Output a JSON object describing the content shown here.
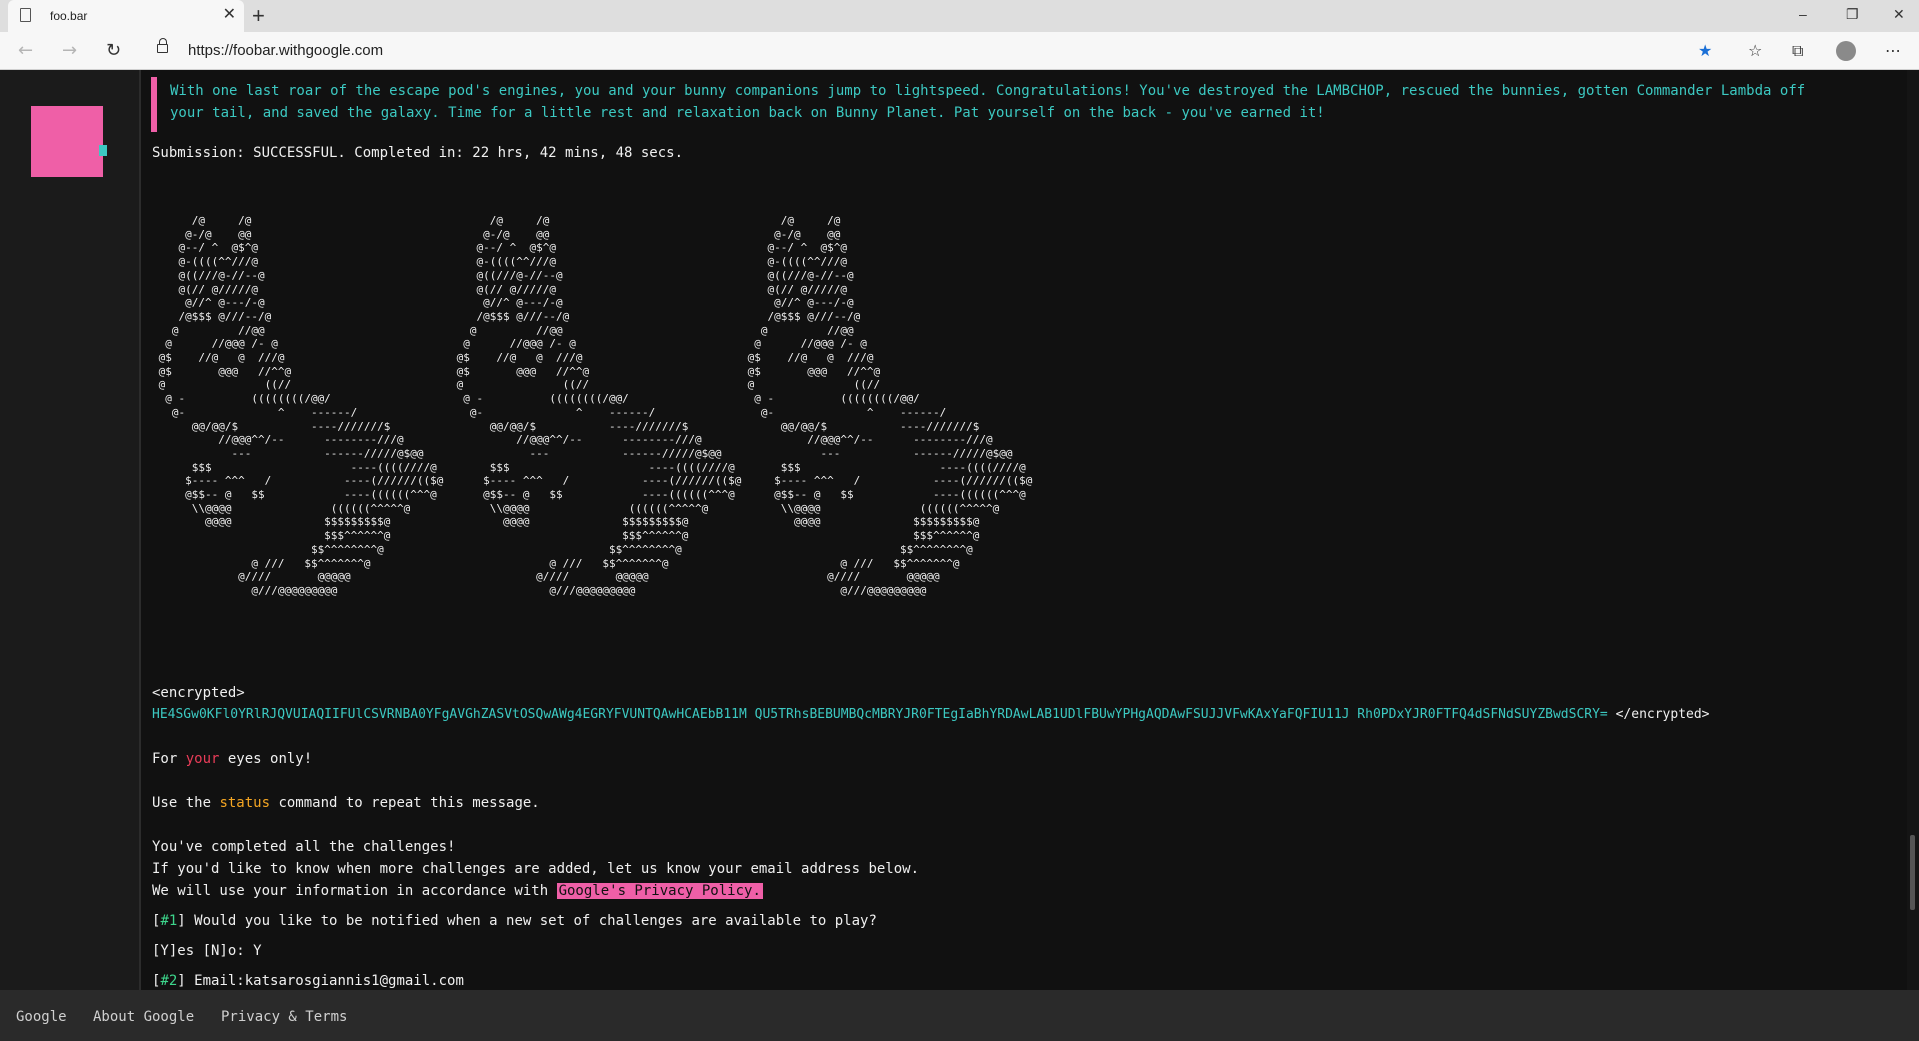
{
  "browser": {
    "tab_title": "foo.bar",
    "new_tab": "+",
    "close_tab": "✕",
    "url": "https://foobar.withgoogle.com",
    "window_controls": {
      "minimize": "–",
      "restore": "❐",
      "close": "✕"
    },
    "icons": [
      "back-icon",
      "forward-icon",
      "reload-icon",
      "lock-icon",
      "star-icon",
      "favorites-icon",
      "collections-icon",
      "profile-icon",
      "more-icon"
    ]
  },
  "terminal": {
    "quote_line1": "With one last roar of the escape pod's engines, you and your bunny companions jump to lightspeed. Congratulations! You've destroyed the LAMBCHOP, rescued the bunnies, gotten Commander Lambda off",
    "quote_line2": "your tail, and saved the galaxy. Time for a little rest and relaxation back on Bunny Planet. Pat yourself on the back - you've earned it!",
    "submission": "Submission: SUCCESSFUL. Completed in: 22 hrs, 42 mins, 48 secs.",
    "ascii_art": "      /@     /@\n     @-/@    @@\n    @--/ ^  @$^@\n    @-((((^^///@\n    @((///@-//--@\n    @(// @/////@\n     @//^ @---/-@\n    /@$$$ @///--/@\n   @         //@@\n  @      //@@@ /- @\n @$    //@   @  ///@\n @$       @@@   //^^@\n @               ((//\n  @ -          ((((((((/@@/\n   @-              ^    ------/\n      @@/@@/$           ----///////$\n          //@@@^^/--      --------///@\n            ---           ------/////@$@@\n      $$$                     ----((((////@\n     $---- ^^^   /           ----(//////(($@\n     @$$-- @   $$            ----((((((^^^@\n      \\\\@@@@               ((((((^^^^^@\n        @@@@              $$$$$$$$$@\n                          $$$^^^^^^@\n                        $$^^^^^^^^@\n               @ ///   $$^^^^^^^@\n             @////       @@@@@\n               @///@@@@@@@@@",
    "encrypted_open": "<encrypted>",
    "encrypted_body": "HE4SGw0KFl0YRlRJQVUIAQIIFUlCSVRNBA0YFgAVGhZASVtOSQwAWg4EGRYFVUNTQAwHCAEbB11M QU5TRhsBEBUMBQcMBRYJR0FTEgIaBhYRDAwLAB1UDlFBUwYPHgAQDAwFSUJJVFwKAxYaFQFIU11J Rh0PDxYJR0FTFQ4dSFNdSUYZBwdSCRY=",
    "encrypted_close": " </encrypted>",
    "eyes_pre": "For ",
    "eyes_word": "your",
    "eyes_post": " eyes only!",
    "status_pre": "Use the ",
    "status_word": "status",
    "status_post": " command to repeat this message.",
    "completed": "You've completed all the challenges!",
    "know_more": "If you'd like to know when more challenges are added, let us know your email address below.",
    "privacy_pre": "We will use your information in accordance with ",
    "privacy_link": "Google's Privacy Policy.",
    "q1_pre": "[",
    "q1_num": "#1",
    "q1_post": "] Would you like to be notified when a new set of challenges are available to play?",
    "yn_prompt": "[Y]es [N]o: Y",
    "q2_pre": "[",
    "q2_num": "#2",
    "q2_post": "] Email:katsarosgiannis1@gmail.com"
  },
  "footer": {
    "google": "Google",
    "about": "About Google",
    "privacy": "Privacy & Terms"
  },
  "colors": {
    "accent_pink": "#ef5fa7",
    "accent_teal": "#3cc9c2",
    "highlight_red": "#e93c58",
    "highlight_orange": "#f5a623",
    "highlight_green": "#3dd68c"
  }
}
